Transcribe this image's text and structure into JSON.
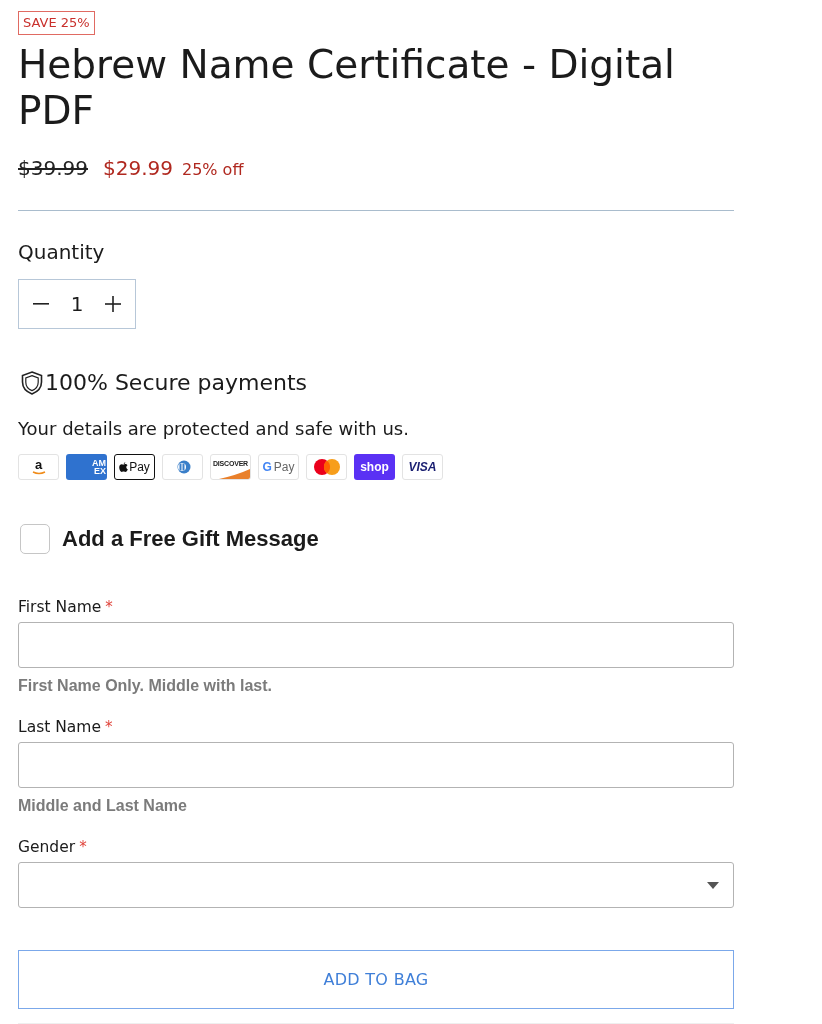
{
  "badge": {
    "label": "SAVE 25%"
  },
  "product": {
    "title": "Hebrew Name Certificate - Digital PDF"
  },
  "price": {
    "compare_at": "$39.99",
    "current": "$29.99",
    "discount": "25% off"
  },
  "quantity": {
    "label": "Quantity",
    "value": "1"
  },
  "security": {
    "heading": "100% Secure payments",
    "note": "Your details are protected and safe with us."
  },
  "payment_methods": [
    {
      "kind": "amazon",
      "label": "a"
    },
    {
      "kind": "amex",
      "label": "AM EX"
    },
    {
      "kind": "applepay",
      "label": "Pay"
    },
    {
      "kind": "diners"
    },
    {
      "kind": "discover",
      "label": "DISCOVER"
    },
    {
      "kind": "googlepay",
      "mark": "G",
      "label": "Pay"
    },
    {
      "kind": "mastercard"
    },
    {
      "kind": "shoppay",
      "label": "shop"
    },
    {
      "kind": "visa",
      "label": "VISA"
    }
  ],
  "gift_message": {
    "label": "Add a Free Gift Message",
    "checked": false
  },
  "fields": [
    {
      "kind": "text",
      "label": "First Name",
      "required_mark": "*",
      "hint": "First Name Only. Middle with last."
    },
    {
      "kind": "text",
      "label": "Last Name",
      "required_mark": "*",
      "hint": "Middle and Last Name"
    },
    {
      "kind": "select",
      "label": "Gender",
      "required_mark": "*"
    }
  ],
  "add_to_bag": {
    "label": "ADD TO BAG"
  }
}
